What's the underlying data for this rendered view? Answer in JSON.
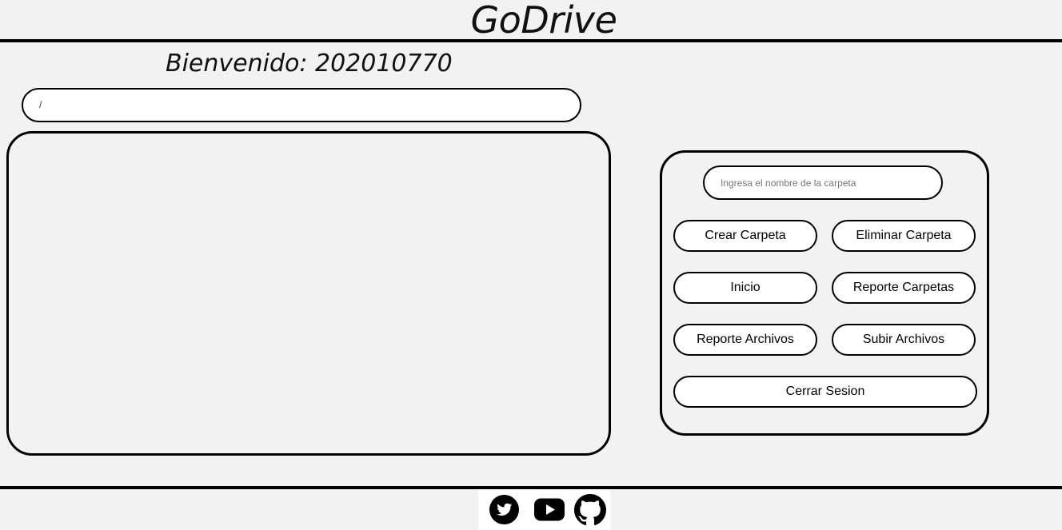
{
  "header": {
    "title": "GoDrive"
  },
  "welcome": {
    "text": "Bienvenido: 202010770"
  },
  "path_bar": {
    "value": "/"
  },
  "panel": {
    "folder_input_placeholder": "Ingresa el nombre de la carpeta",
    "buttons": {
      "create_folder": "Crear Carpeta",
      "delete_folder": "Eliminar Carpeta",
      "home": "Inicio",
      "folders_report": "Reporte Carpetas",
      "files_report": "Reporte Archivos",
      "upload_files": "Subir Archivos",
      "logout": "Cerrar Sesion"
    }
  },
  "footer": {
    "icons": [
      "twitter-icon",
      "youtube-icon",
      "github-icon"
    ]
  }
}
